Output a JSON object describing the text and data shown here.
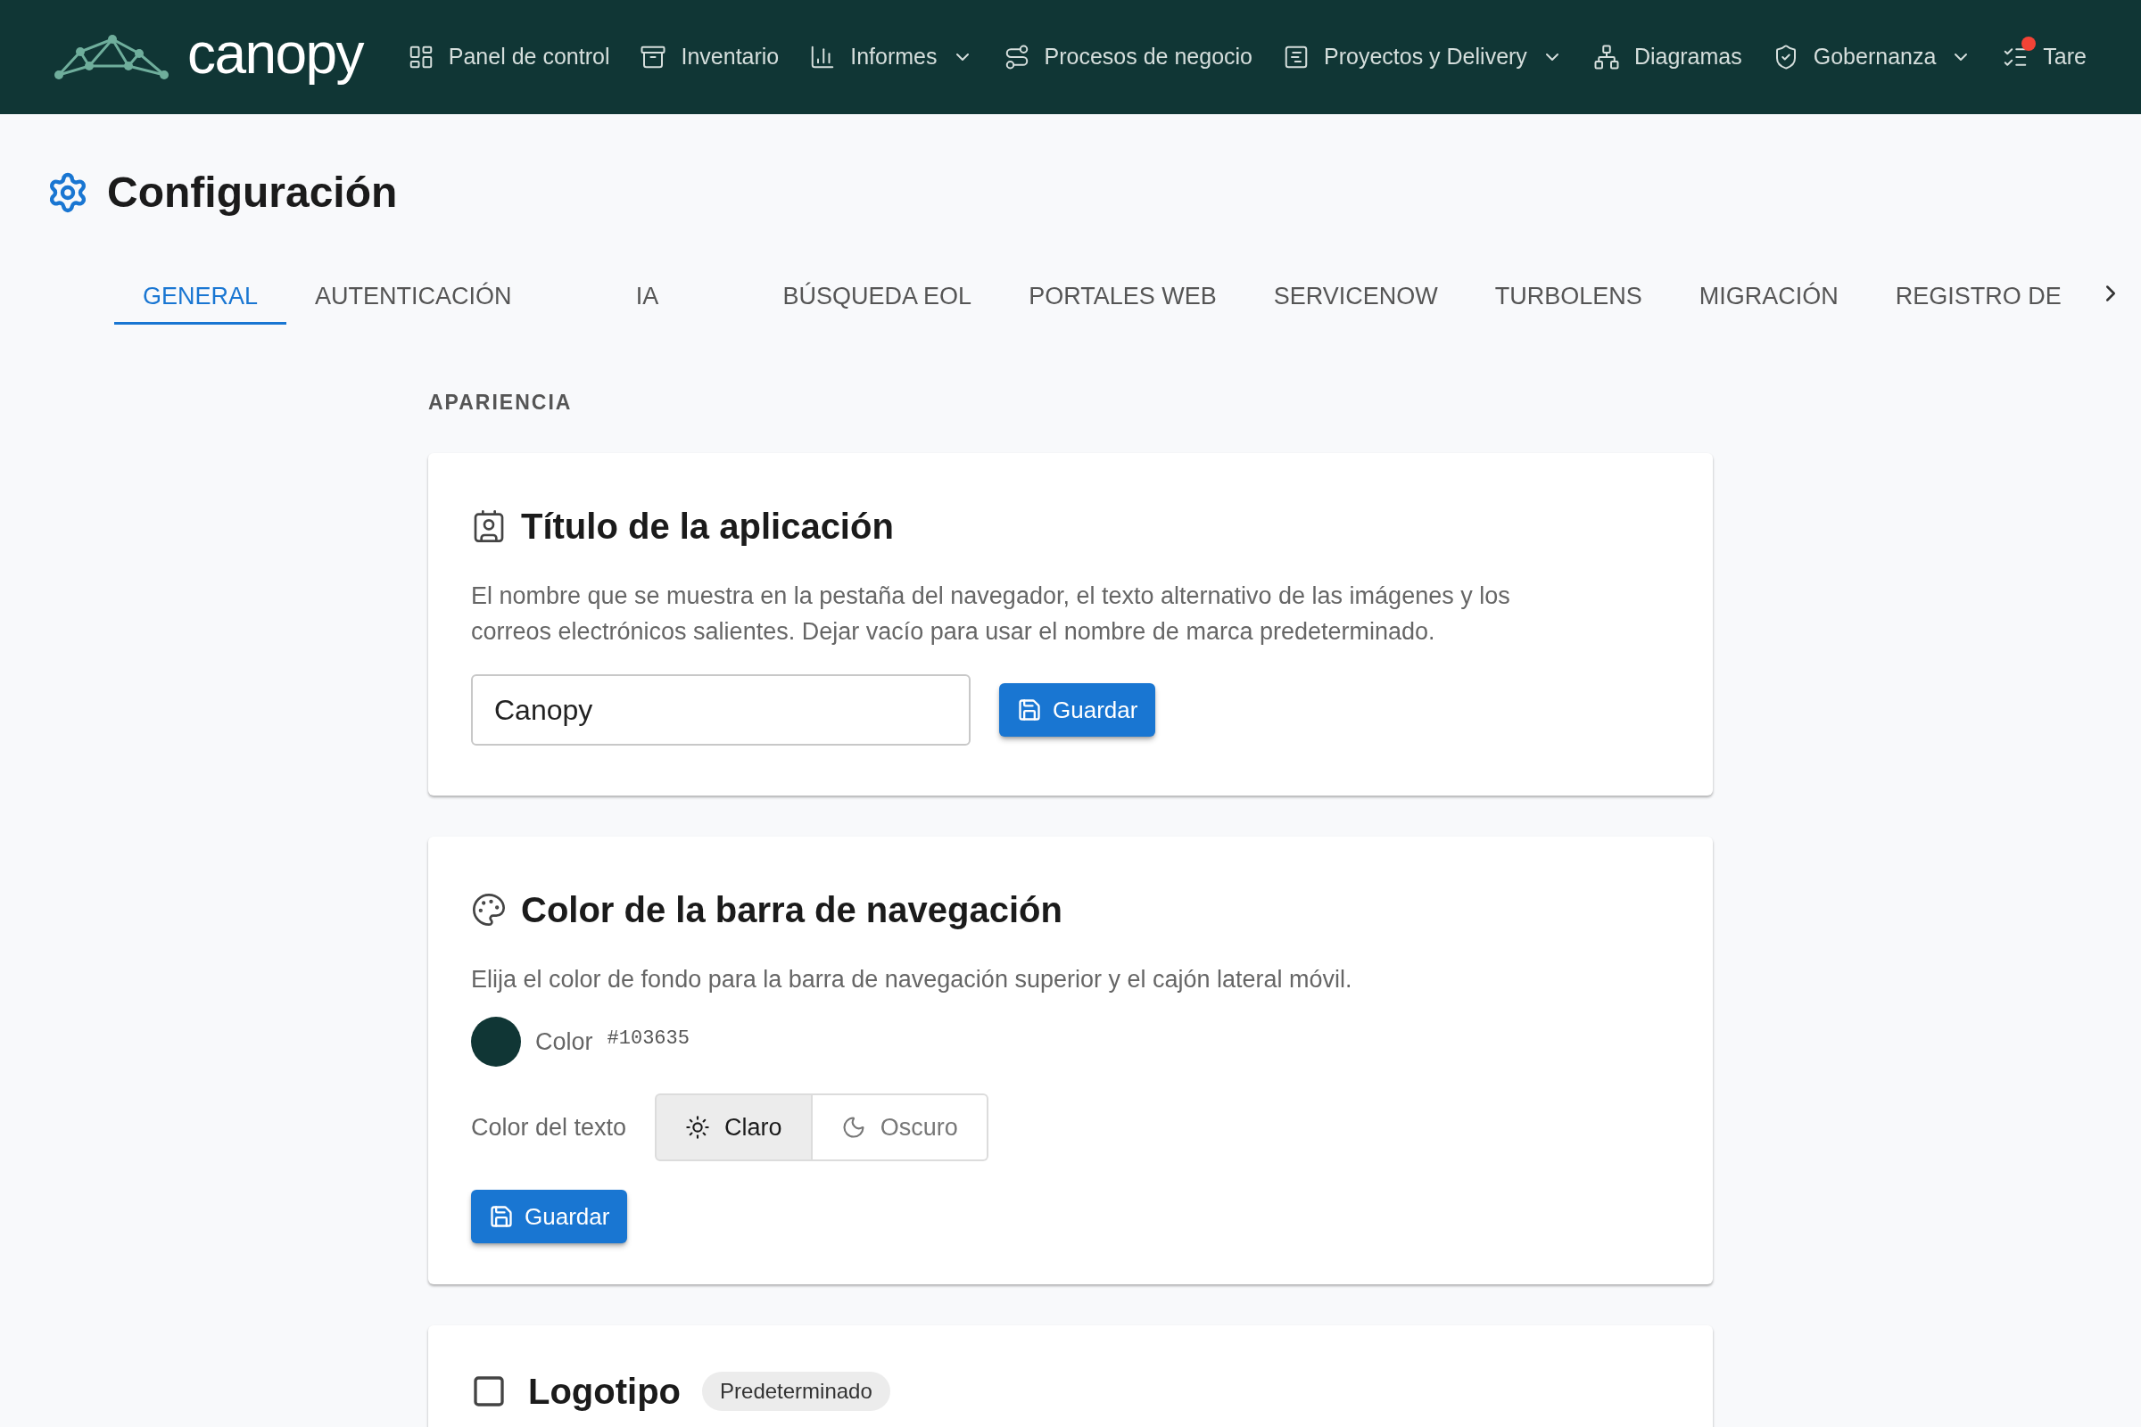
{
  "navbar": {
    "brand": "canopy",
    "items": [
      {
        "label": "Panel de control",
        "dropdown": false,
        "has_dot": false
      },
      {
        "label": "Inventario",
        "dropdown": false,
        "has_dot": false
      },
      {
        "label": "Informes",
        "dropdown": true,
        "has_dot": false
      },
      {
        "label": "Procesos de negocio",
        "dropdown": false,
        "has_dot": false
      },
      {
        "label": "Proyectos y Delivery",
        "dropdown": true,
        "has_dot": false
      },
      {
        "label": "Diagramas",
        "dropdown": false,
        "has_dot": false
      },
      {
        "label": "Gobernanza",
        "dropdown": true,
        "has_dot": false
      },
      {
        "label": "Tare",
        "dropdown": false,
        "has_dot": true
      }
    ]
  },
  "page": {
    "title": "Configuración"
  },
  "tabs": [
    {
      "label": "GENERAL",
      "selected": true
    },
    {
      "label": "AUTENTICACIÓN",
      "selected": false
    },
    {
      "label": "IA",
      "selected": false
    },
    {
      "label": "BÚSQUEDA EOL",
      "selected": false
    },
    {
      "label": "PORTALES WEB",
      "selected": false
    },
    {
      "label": "SERVICENOW",
      "selected": false
    },
    {
      "label": "TURBOLENS",
      "selected": false
    },
    {
      "label": "MIGRACIÓN",
      "selected": false
    },
    {
      "label": "REGISTRO DE",
      "selected": false
    }
  ],
  "section": {
    "label": "APARIENCIA"
  },
  "app_title_card": {
    "title": "Título de la aplicación",
    "description": "El nombre que se muestra en la pestaña del navegador, el texto alternativo de las imágenes y los correos electrónicos salientes. Dejar vacío para usar el nombre de marca predeterminado.",
    "value": "Canopy",
    "button": "Guardar"
  },
  "navbar_color_card": {
    "title": "Color de la barra de navegación",
    "description": "Elija el color de fondo para la barra de navegación superior y el cajón lateral móvil.",
    "color_label": "Color",
    "color": "#103635",
    "color_code": "#103635",
    "text_color_label": "Color del texto",
    "text_color_options": [
      {
        "label": "Claro",
        "kind": "light",
        "selected": true
      },
      {
        "label": "Oscuro",
        "kind": "dark",
        "selected": false
      }
    ],
    "button": "Guardar"
  },
  "logo_card": {
    "title": "Logotipo",
    "badge": "Predeterminado"
  }
}
